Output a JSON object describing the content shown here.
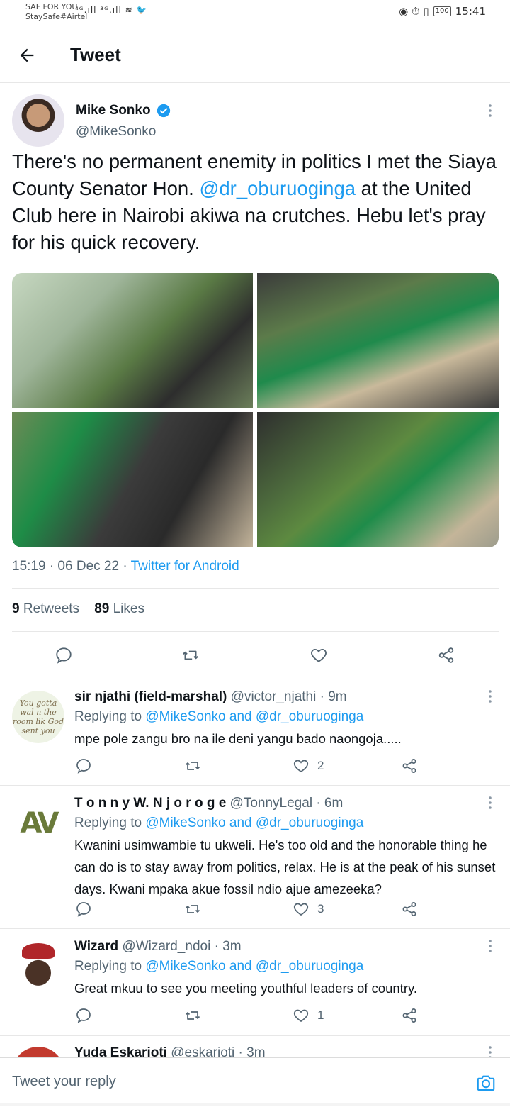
{
  "status_bar": {
    "carrier_1": "SAF FOR YOU",
    "carrier_2": "StaySafe#Airtel",
    "left_icons": "⁴ᴳ.ıll ³ᴳ.ıll ≋ 🐦",
    "right_icons": "◉ ⏱ ▯",
    "battery": "100",
    "time": "15:41"
  },
  "header": {
    "title": "Tweet"
  },
  "tweet": {
    "author_name": "Mike Sonko",
    "author_handle": "@MikeSonko",
    "text_part1": "There's no permanent enemity in politics I met the Siaya County Senator Hon. ",
    "mention": "@dr_oburuoginga",
    "text_part2": " at the United Club here in Nairobi akiwa na crutches. Hebu let's pray for his quick recovery.",
    "time": "15:19 · 06 Dec 22 · ",
    "source": "Twitter for Android",
    "retweets_count": "9",
    "retweets_label": " Retweets",
    "likes_count": "89",
    "likes_label": " Likes"
  },
  "replies": [
    {
      "name": "sir njathi (field-marshal)",
      "handle": " @victor_njathi · 9m",
      "replying_label": "Replying to ",
      "replying_to": "@MikeSonko and @dr_oburuoginga",
      "text": "mpe pole zangu bro na ile deni yangu bado naongoja.....",
      "avatar_text": "You gotta wal n the room lik God sent you",
      "likes": "2"
    },
    {
      "name": "T o n n y W. N j o r o g e",
      "handle": " @TonnyLegal · 6m",
      "replying_label": "Replying to ",
      "replying_to": "@MikeSonko and @dr_oburuoginga",
      "text": "Kwanini usimwambie tu ukweli. He's too old and the honorable thing he can  do is to stay away from politics, relax. He is at the peak of his sunset days. Kwani mpaka  akue fossil ndio ajue amezeeka?",
      "avatar_text": "AV",
      "likes": "3"
    },
    {
      "name": "Wizard",
      "handle": " @Wizard_ndoi · 3m",
      "replying_label": "Replying to ",
      "replying_to": "@MikeSonko and @dr_oburuoginga",
      "text": "Great mkuu to see you meeting youthful leaders of  country.",
      "likes": "1"
    },
    {
      "name": "Yuda Eskarioti",
      "handle": " @eskarioti · 3m"
    }
  ],
  "composer": {
    "placeholder": "Tweet your reply"
  },
  "icons": {
    "back": "arrow-left-icon",
    "verified": "verified-badge-icon",
    "more": "more-vertical-icon",
    "reply": "reply-bubble-icon",
    "retweet": "retweet-icon",
    "like": "heart-icon",
    "share": "share-icon",
    "camera": "camera-icon"
  },
  "colors": {
    "accent": "#1d9bf0",
    "text": "#0f1419",
    "secondary": "#536471",
    "divider": "#e7e7e7"
  }
}
